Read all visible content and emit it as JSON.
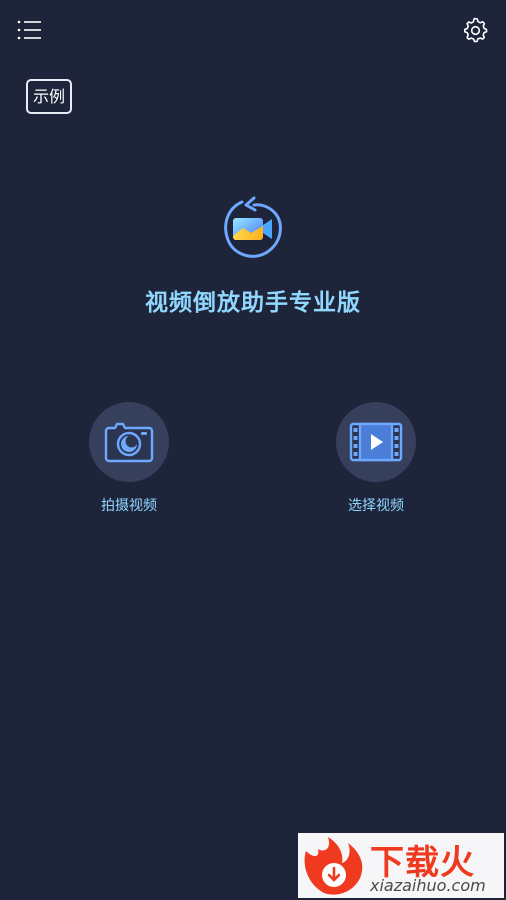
{
  "header": {
    "menu_icon": "list-menu-icon",
    "settings_icon": "gear-icon",
    "example_label": "示例"
  },
  "main": {
    "logo_icon": "rewind-video-logo-icon",
    "title": "视频倒放助手专业版",
    "actions": [
      {
        "label": "拍摄视频",
        "icon": "camera-icon"
      },
      {
        "label": "选择视频",
        "icon": "film-play-icon"
      }
    ]
  },
  "watermark": {
    "brand": "下载火",
    "domain": "xiazaihuo.com"
  },
  "colors": {
    "background": "#1e2439",
    "accent_text": "#8fd7ff",
    "icon_blue": "#6ea8ff",
    "circle_bg": "#36405c"
  }
}
